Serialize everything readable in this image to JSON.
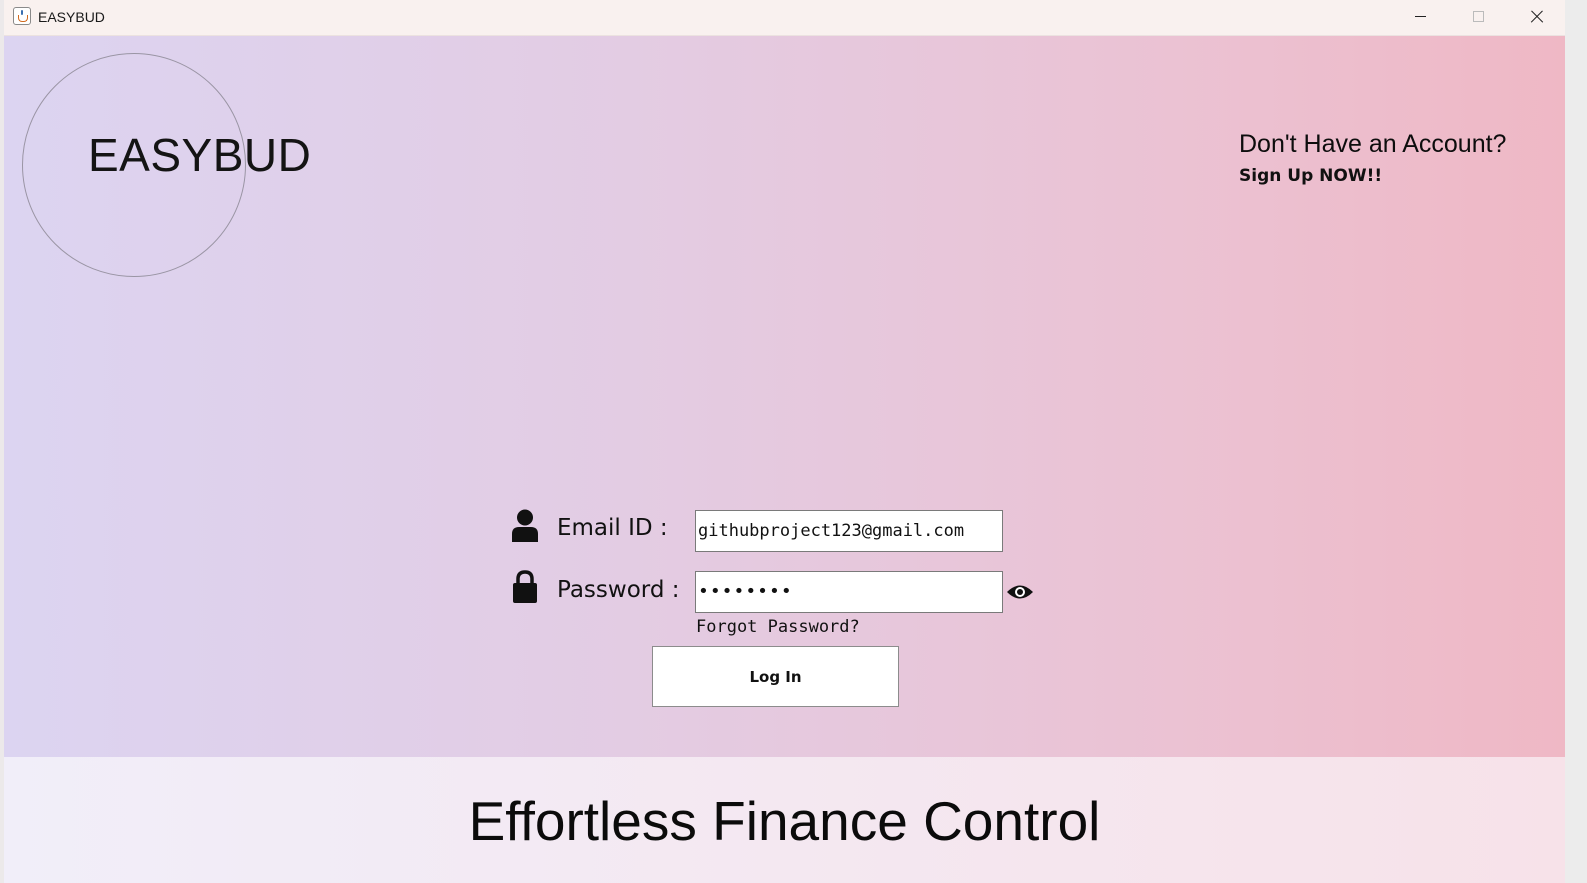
{
  "window": {
    "title": "EASYBUD"
  },
  "header": {
    "logo_text": "EASYBUD",
    "signup_prompt": "Don't Have an Account?",
    "signup_link": "Sign Up NOW!!"
  },
  "login_form": {
    "email_label": "Email ID :",
    "email_value": "githubproject123@gmail.com",
    "password_label": "Password :",
    "password_masked": "••••••••",
    "forgot_password": "Forgot Password?",
    "login_button": "Log In"
  },
  "footer": {
    "tagline": "Effortless Finance Control"
  },
  "icons": {
    "app": "java-cup-icon",
    "email": "user-icon",
    "password": "lock-icon",
    "show_password": "eye-icon"
  },
  "colors": {
    "gradient_left": "#dcd4f1",
    "gradient_right": "#efb8c5",
    "footer_bg": "#f4e8f1"
  }
}
